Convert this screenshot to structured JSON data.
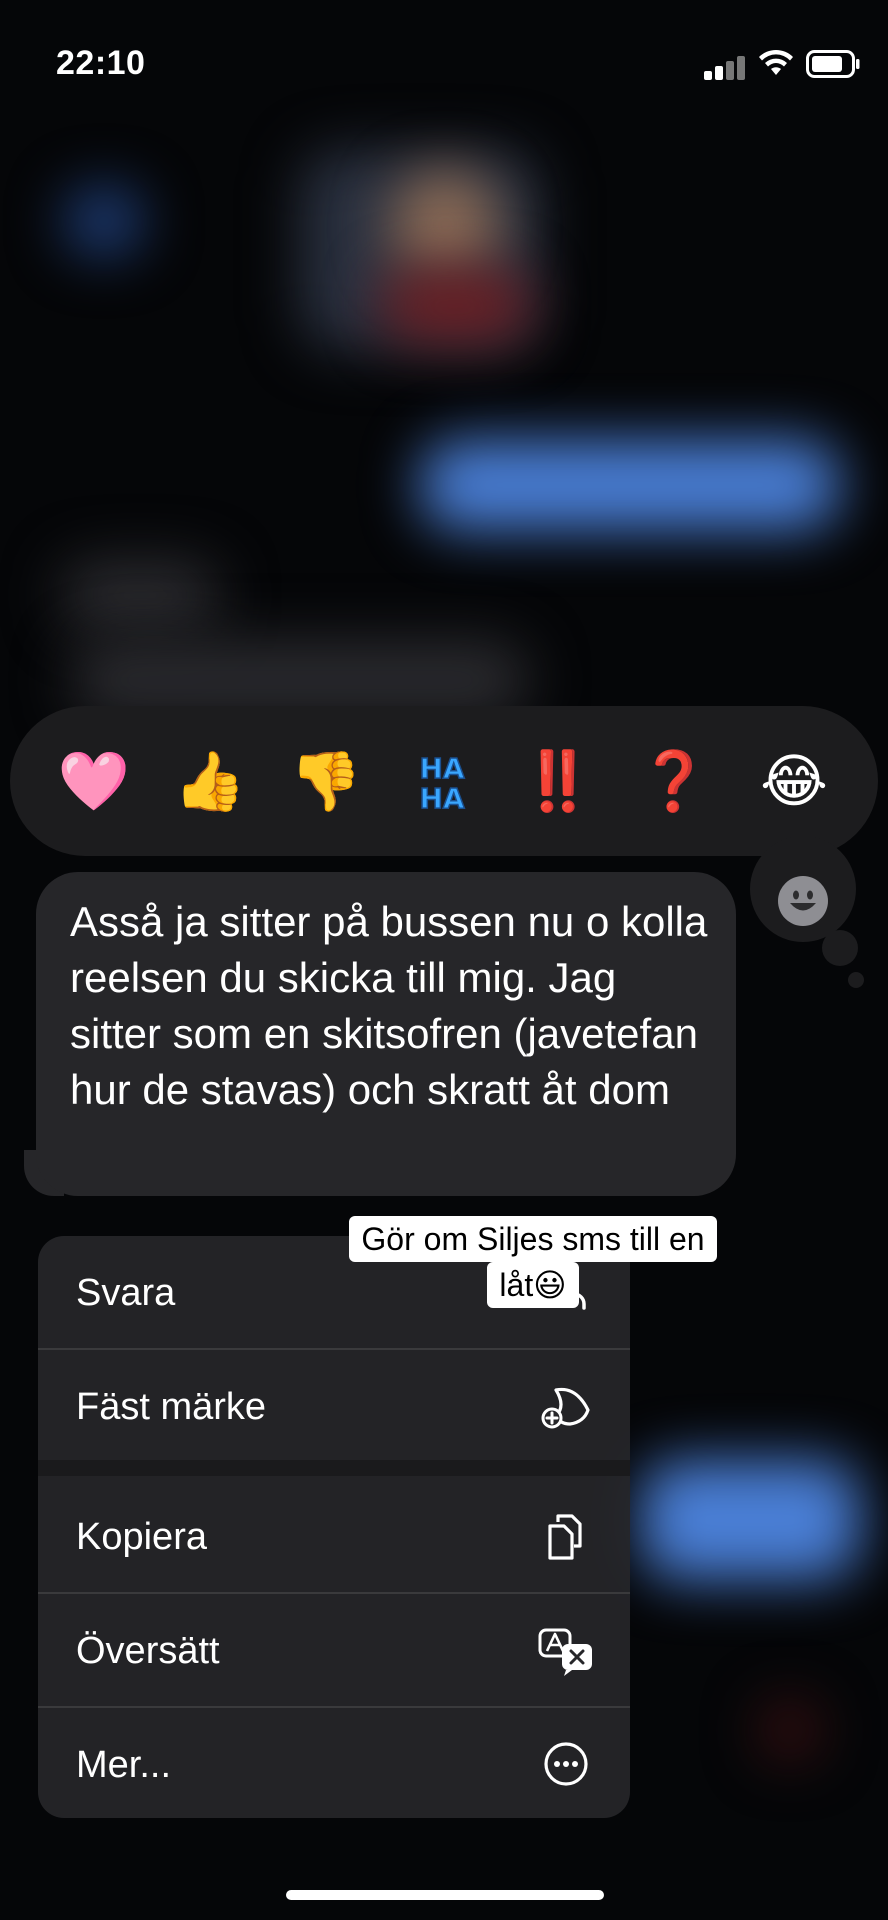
{
  "status_bar": {
    "time": "22:10"
  },
  "reactions": [
    {
      "name": "heart-reaction",
      "glyph": "🩷"
    },
    {
      "name": "thumbs-up-reaction",
      "glyph": "👍"
    },
    {
      "name": "thumbs-down-reaction",
      "glyph": "👎"
    },
    {
      "name": "haha-reaction",
      "glyph": "HA HA"
    },
    {
      "name": "exclamation-reaction",
      "glyph": "‼️"
    },
    {
      "name": "question-reaction",
      "glyph": "❓"
    },
    {
      "name": "laughing-reaction",
      "glyph": "😂"
    }
  ],
  "message": {
    "text": "Asså ja sitter på bussen nu o kolla reelsen du skicka till mig. Jag sitter som en skitsofren (javetefan hur de stavas) och skratt åt dom"
  },
  "caption": {
    "line1": "Gör om Siljes sms till en",
    "line2": "låt😃"
  },
  "menu": {
    "items": [
      {
        "label": "Svara",
        "icon": "reply-icon"
      },
      {
        "label": "Fäst märke",
        "icon": "sticker-add-icon"
      },
      {
        "label": "Kopiera",
        "icon": "copy-icon"
      },
      {
        "label": "Översätt",
        "icon": "translate-icon"
      },
      {
        "label": "Mer...",
        "icon": "more-icon"
      }
    ]
  },
  "colors": {
    "bubble": "#262629",
    "menu": "#262629",
    "blurred_bubble": "#4a7fd6"
  }
}
